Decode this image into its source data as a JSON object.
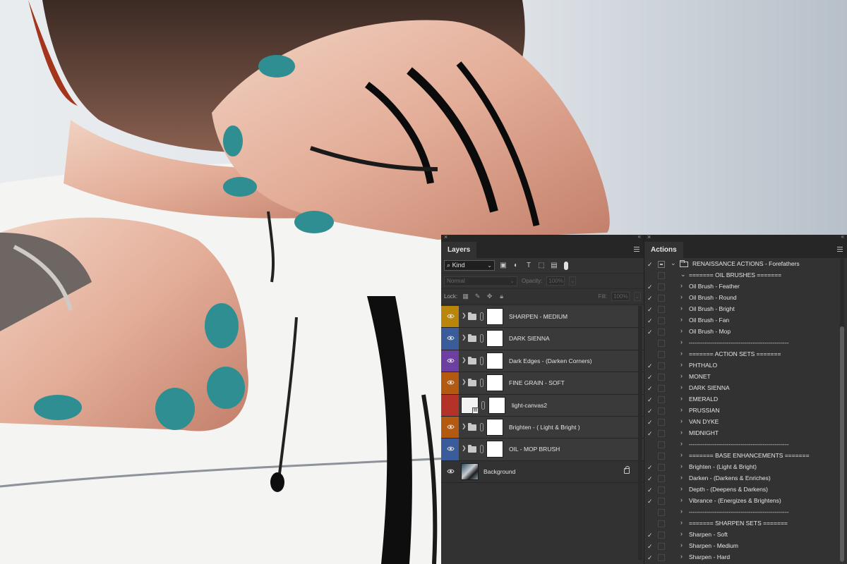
{
  "layers_panel": {
    "tab": "Layers",
    "filter_kind": "Kind",
    "blend_mode": "Normal",
    "opacity_label": "Opacity:",
    "opacity_value": "100%",
    "lock_label": "Lock:",
    "fill_label": "Fill:",
    "fill_value": "100%",
    "layers": [
      {
        "name": "SHARPEN - MEDIUM",
        "color": "#b8860b",
        "type": "group",
        "visible": true
      },
      {
        "name": "DARK SIENNA",
        "color": "#3b5c9a",
        "type": "group",
        "visible": true
      },
      {
        "name": "Dark Edges - (Darken Corners)",
        "color": "#6d3fa0",
        "type": "group",
        "visible": true
      },
      {
        "name": "FINE GRAIN - SOFT",
        "color": "#b35a12",
        "type": "group",
        "visible": true
      },
      {
        "name": "light-canvas2",
        "color": "#b53228",
        "type": "smart",
        "visible": false
      },
      {
        "name": "Brighten - ( Light & Bright )",
        "color": "#b35a12",
        "type": "group",
        "visible": true
      },
      {
        "name": "OIL - MOP BRUSH",
        "color": "#3b5c9a",
        "type": "group",
        "visible": true
      },
      {
        "name": "Background",
        "color": "",
        "type": "background",
        "visible": true
      }
    ]
  },
  "actions_panel": {
    "tab": "Actions",
    "items": [
      {
        "label": "RENAISSANCE ACTIONS - Forefathers",
        "level": 0,
        "checked": true,
        "dialog": true,
        "expanded": true,
        "folder": true
      },
      {
        "label": "======= OIL BRUSHES =======",
        "level": 1,
        "checked": false,
        "dialog": false,
        "expanded": true,
        "folder": false
      },
      {
        "label": "Oil Brush - Feather",
        "level": 1,
        "checked": true,
        "dialog": false,
        "expanded": false,
        "folder": false
      },
      {
        "label": "Oil Brush - Round",
        "level": 1,
        "checked": true,
        "dialog": false,
        "expanded": false,
        "folder": false
      },
      {
        "label": "Oil Brush - Bright",
        "level": 1,
        "checked": true,
        "dialog": false,
        "expanded": false,
        "folder": false
      },
      {
        "label": "Oil Brush - Fan",
        "level": 1,
        "checked": true,
        "dialog": false,
        "expanded": false,
        "folder": false
      },
      {
        "label": "Oil Brush - Mop",
        "level": 1,
        "checked": true,
        "dialog": false,
        "expanded": false,
        "folder": false
      },
      {
        "label": "--------------------------------------------------",
        "level": 1,
        "checked": false,
        "dialog": false,
        "expanded": false,
        "folder": false
      },
      {
        "label": "======= ACTION SETS =======",
        "level": 1,
        "checked": false,
        "dialog": false,
        "expanded": false,
        "folder": false
      },
      {
        "label": "PHTHALO",
        "level": 1,
        "checked": true,
        "dialog": false,
        "expanded": false,
        "folder": false
      },
      {
        "label": "MONET",
        "level": 1,
        "checked": true,
        "dialog": false,
        "expanded": false,
        "folder": false
      },
      {
        "label": "DARK SIENNA",
        "level": 1,
        "checked": true,
        "dialog": false,
        "expanded": false,
        "folder": false
      },
      {
        "label": "EMERALD",
        "level": 1,
        "checked": true,
        "dialog": false,
        "expanded": false,
        "folder": false
      },
      {
        "label": "PRUSSIAN",
        "level": 1,
        "checked": true,
        "dialog": false,
        "expanded": false,
        "folder": false
      },
      {
        "label": "VAN DYKE",
        "level": 1,
        "checked": true,
        "dialog": false,
        "expanded": false,
        "folder": false
      },
      {
        "label": "MIDNIGHT",
        "level": 1,
        "checked": true,
        "dialog": false,
        "expanded": false,
        "folder": false
      },
      {
        "label": "--------------------------------------------------",
        "level": 1,
        "checked": false,
        "dialog": false,
        "expanded": false,
        "folder": false
      },
      {
        "label": "======= BASE ENHANCEMENTS =======",
        "level": 1,
        "checked": false,
        "dialog": false,
        "expanded": false,
        "folder": false
      },
      {
        "label": "Brighten - (Light & Bright)",
        "level": 1,
        "checked": true,
        "dialog": false,
        "expanded": false,
        "folder": false
      },
      {
        "label": "Darken - (Darkens & Enriches)",
        "level": 1,
        "checked": true,
        "dialog": false,
        "expanded": false,
        "folder": false
      },
      {
        "label": "Depth - (Deepens & Darkens)",
        "level": 1,
        "checked": true,
        "dialog": false,
        "expanded": false,
        "folder": false
      },
      {
        "label": "Vibrance - (Energizes & Brightens)",
        "level": 1,
        "checked": true,
        "dialog": false,
        "expanded": false,
        "folder": false
      },
      {
        "label": "--------------------------------------------------",
        "level": 1,
        "checked": false,
        "dialog": false,
        "expanded": false,
        "folder": false
      },
      {
        "label": "======= SHARPEN SETS =======",
        "level": 1,
        "checked": false,
        "dialog": false,
        "expanded": false,
        "folder": false
      },
      {
        "label": "Sharpen - Soft",
        "level": 1,
        "checked": true,
        "dialog": false,
        "expanded": false,
        "folder": false
      },
      {
        "label": "Sharpen - Medium",
        "level": 1,
        "checked": true,
        "dialog": false,
        "expanded": false,
        "folder": false
      },
      {
        "label": "Sharpen - Hard",
        "level": 1,
        "checked": true,
        "dialog": false,
        "expanded": false,
        "folder": false
      }
    ]
  }
}
